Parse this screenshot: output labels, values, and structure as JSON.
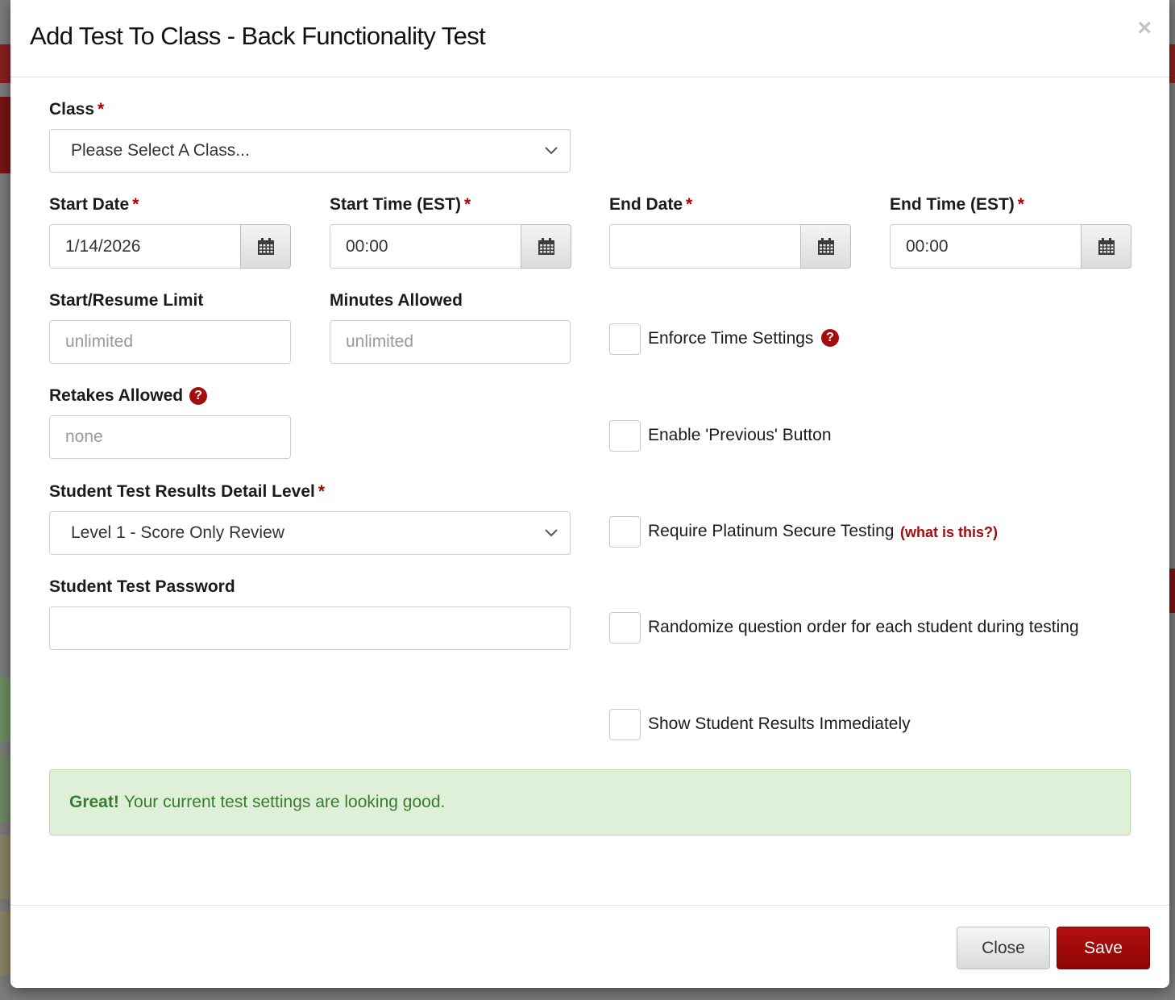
{
  "modal": {
    "title": "Add Test To Class - Back Functionality Test",
    "close_glyph": "×"
  },
  "required_marker": "*",
  "class_field": {
    "label": "Class",
    "value": "Please Select A Class..."
  },
  "start_date": {
    "label": "Start Date",
    "value": "1/14/2026",
    "icon": "calendar-icon"
  },
  "start_time": {
    "label": "Start Time (EST)",
    "value": "00:00",
    "icon": "calendar-icon"
  },
  "end_date": {
    "label": "End Date",
    "value": "",
    "icon": "calendar-icon"
  },
  "end_time": {
    "label": "End Time (EST)",
    "value": "00:00",
    "icon": "calendar-icon"
  },
  "start_resume_limit": {
    "label": "Start/Resume Limit",
    "placeholder": "unlimited"
  },
  "minutes_allowed": {
    "label": "Minutes Allowed",
    "placeholder": "unlimited"
  },
  "retakes_allowed": {
    "label": "Retakes Allowed",
    "placeholder": "none",
    "help_glyph": "?"
  },
  "results_detail": {
    "label": "Student Test Results Detail Level",
    "value": "Level 1 - Score Only Review"
  },
  "test_password": {
    "label": "Student Test Password",
    "value": ""
  },
  "checkboxes": {
    "enforce_time": {
      "label": "Enforce Time Settings",
      "checked": false,
      "help_glyph": "?"
    },
    "enable_previous": {
      "label": "Enable 'Previous' Button",
      "checked": false
    },
    "platinum_secure": {
      "label": "Require Platinum Secure Testing",
      "checked": false,
      "link": "(what is this?)"
    },
    "randomize": {
      "label": "Randomize question order for each student during testing",
      "checked": false
    },
    "show_results": {
      "label": "Show Student Results Immediately",
      "checked": false
    }
  },
  "alert": {
    "strong": "Great!",
    "text": "Your current test settings are looking good."
  },
  "footer": {
    "close_label": "Close",
    "save_label": "Save"
  },
  "colors": {
    "accent": "#a30d0d",
    "success_bg": "#dff0d8",
    "success_text": "#3a7a32"
  }
}
